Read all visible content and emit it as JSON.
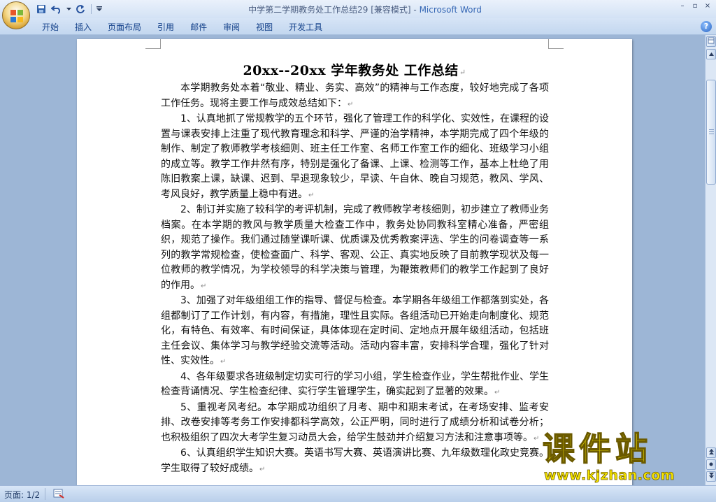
{
  "window": {
    "title_doc": "中学第二学期教务处工作总结29 [兼容模式] - ",
    "title_app": "Microsoft Word",
    "controls": [
      "–",
      "▫",
      "×"
    ]
  },
  "ribbon": {
    "tabs": [
      "开始",
      "插入",
      "页面布局",
      "引用",
      "邮件",
      "审阅",
      "视图",
      "开发工具"
    ]
  },
  "document": {
    "title": "20xx--20xx 学年教务处  工作总结",
    "paragraphs": [
      "本学期教务处本着“敬业、精业、务实、高效”的精神与工作态度，较好地完成了各项工作任务。现将主要工作与成效总结如下：",
      "1、认真地抓了常规教学的五个环节，强化了管理工作的科学化、实效性，在课程的设置与课表安排上注重了现代教育理念和科学、严谨的治学精神，本学期完成了四个年级的制作、制定了教师教学考核细则、班主任工作室、名师工作室工作的细化、班级学习小组的成立等。教学工作井然有序，特别是强化了备课、上课、检测等工作，基本上杜绝了用陈旧教案上课，缺课、迟到、早退现象较少，早读、午自休、晚自习规范，教风、学风、考风良好，教学质量上稳中有进。",
      "2、制订并实施了较科学的考评机制，完成了教师教学考核细则，初步建立了教师业务档案。在本学期的教风与教学质量大检查工作中，教务处协同教科室精心准备，严密组织，规范了操作。我们通过随堂课听课、优质课及优秀教案评选、学生的问卷调查等一系列的教学常规检查，使检查面广、科学、客观、公正、真实地反映了目前教学现状及每一位教师的教学情况，为学校领导的科学决策与管理，为鞭策教师们的教学工作起到了良好的作用。",
      "3、加强了对年级组组工作的指导、督促与检查。本学期各年级组工作都落到实处，各组都制订了工作计划，有内容，有措施，理性且实际。各组活动已开始走向制度化、规范化，有特色、有效率、有时间保证，具体体现在定时间、定地点开展年级组活动，包括班主任会议、集体学习与教学经验交流等活动。活动内容丰富，安排科学合理，强化了针对性、实效性。",
      "4、各年级要求各班级制定切实可行的学习小组，学生检查作业，学生帮批作业、学生检查背诵情况、学生检查纪律、实行学生管理学生，确实起到了显著的效果。",
      "5、重视考风考纪。本学期成功组织了月考、期中和期末考试，在考场安排、监考安排、改卷安排等考务工作安排都科学高效，公正严明，同时进行了成绩分析和试卷分析；也积极组织了四次大考学生复习动员大会，给学生鼓劲并介绍复习方法和注意事项等。",
      "6、认真组织学生知识大赛。英语书写大赛、英语演讲比赛、九年级数理化政史竞赛。学生取得了较好成绩。"
    ]
  },
  "watermark": {
    "title": "课件站",
    "url": "www.kjzhan.com"
  },
  "statusbar": {
    "page_label": "页面: 1/2"
  },
  "colors": {
    "ribbon_text": "#15428b",
    "app_title": "#3466b4",
    "watermark": "#f7e600"
  }
}
